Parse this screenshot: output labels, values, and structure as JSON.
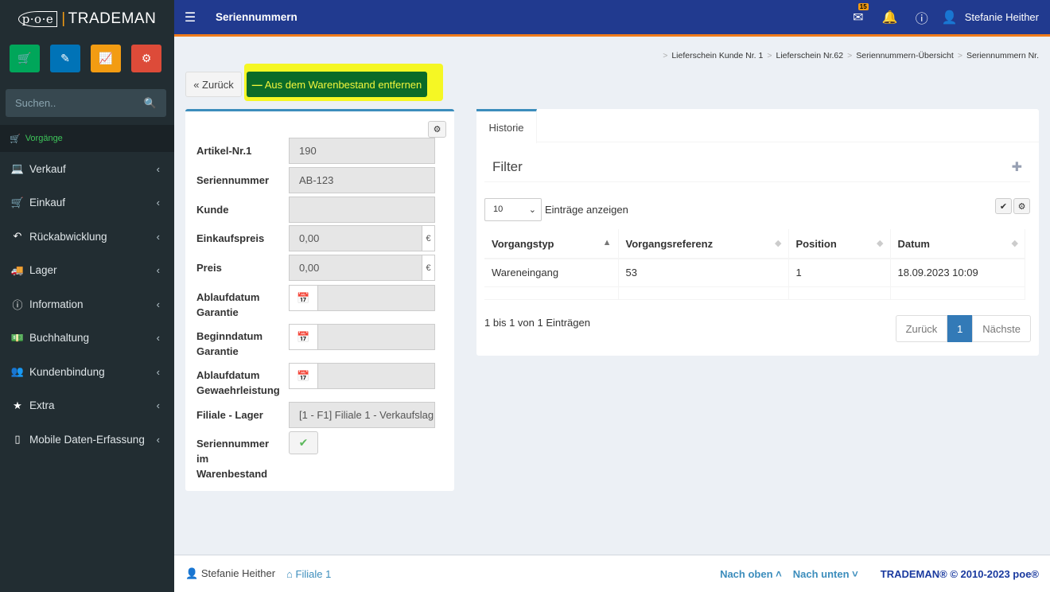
{
  "brand": {
    "poe": "p·o·e",
    "name": "TRADEMAN"
  },
  "quick_buttons": [
    {
      "icon": "cart-icon",
      "color": "#00a65a",
      "glyph": "🛒"
    },
    {
      "icon": "pencil-icon",
      "color": "#0073b7",
      "glyph": "✎"
    },
    {
      "icon": "chart-icon",
      "color": "#f39c12",
      "glyph": "📈"
    },
    {
      "icon": "cogs-icon",
      "color": "#dd4b39",
      "glyph": "⚙"
    }
  ],
  "search": {
    "placeholder": "Suchen.."
  },
  "sidebar": {
    "section": "Vorgänge",
    "items": [
      {
        "label": "Verkauf",
        "icon": "desktop-icon"
      },
      {
        "label": "Einkauf",
        "icon": "cart-icon"
      },
      {
        "label": "Rückabwicklung",
        "icon": "undo-icon"
      },
      {
        "label": "Lager",
        "icon": "truck-icon"
      },
      {
        "label": "Information",
        "icon": "info-icon"
      },
      {
        "label": "Buchhaltung",
        "icon": "money-icon"
      },
      {
        "label": "Kundenbindung",
        "icon": "users-icon"
      },
      {
        "label": "Extra",
        "icon": "star-icon"
      },
      {
        "label": "Mobile Daten-Erfassung",
        "icon": "mobile-icon"
      }
    ]
  },
  "header": {
    "title": "Seriennummern",
    "mail_badge": "15",
    "user": "Stefanie Heither"
  },
  "breadcrumb": [
    "Lieferschein Kunde Nr. 1",
    "Lieferschein Nr.62",
    "Seriennummern-Übersicht",
    "Seriennummern Nr."
  ],
  "toolbar": {
    "back": "« Zurück",
    "remove": "Aus dem Warenbestand entfernen"
  },
  "form": {
    "artikel_label": "Artikel-Nr.1",
    "artikel_value": "190",
    "serien_label": "Seriennummer",
    "serien_value": "AB-123",
    "kunde_label": "Kunde",
    "kunde_value": "",
    "einkauf_label": "Einkaufspreis",
    "einkauf_value": "0,00",
    "preis_label": "Preis",
    "preis_value": "0,00",
    "currency": "€",
    "ablauf_garantie_label_1": "Ablaufdatum",
    "ablauf_garantie_label_2": "Garantie",
    "beginn_garantie_label_1": "Beginndatum",
    "beginn_garantie_label_2": "Garantie",
    "ablauf_gewaehr_label_1": "Ablaufdatum",
    "ablauf_gewaehr_label_2": "Gewaehrleistung",
    "filiale_label": "Filiale - Lager",
    "filiale_value": "[1 - F1] Filiale 1 - Verkaufslag",
    "im_bestand_label_1": "Seriennummer",
    "im_bestand_label_2": "im",
    "im_bestand_label_3": "Warenbestand",
    "im_bestand_checked": true
  },
  "history": {
    "tab": "Historie",
    "filter": "Filter",
    "page_length": "10",
    "length_label": "Einträge anzeigen",
    "columns": [
      "Vorgangstyp",
      "Vorgangsreferenz",
      "Position",
      "Datum"
    ],
    "rows": [
      [
        "Wareneingang",
        "53",
        "1",
        "18.09.2023 10:09"
      ]
    ],
    "info": "1 bis 1 von 1 Einträgen",
    "pager": {
      "prev": "Zurück",
      "current": "1",
      "next": "Nächste"
    }
  },
  "footer": {
    "user": "Stefanie Heither",
    "filiale": "Filiale 1",
    "up": "Nach oben",
    "down": "Nach unten",
    "copyright": "TRADEMAN® © 2010-2023 poe®"
  }
}
